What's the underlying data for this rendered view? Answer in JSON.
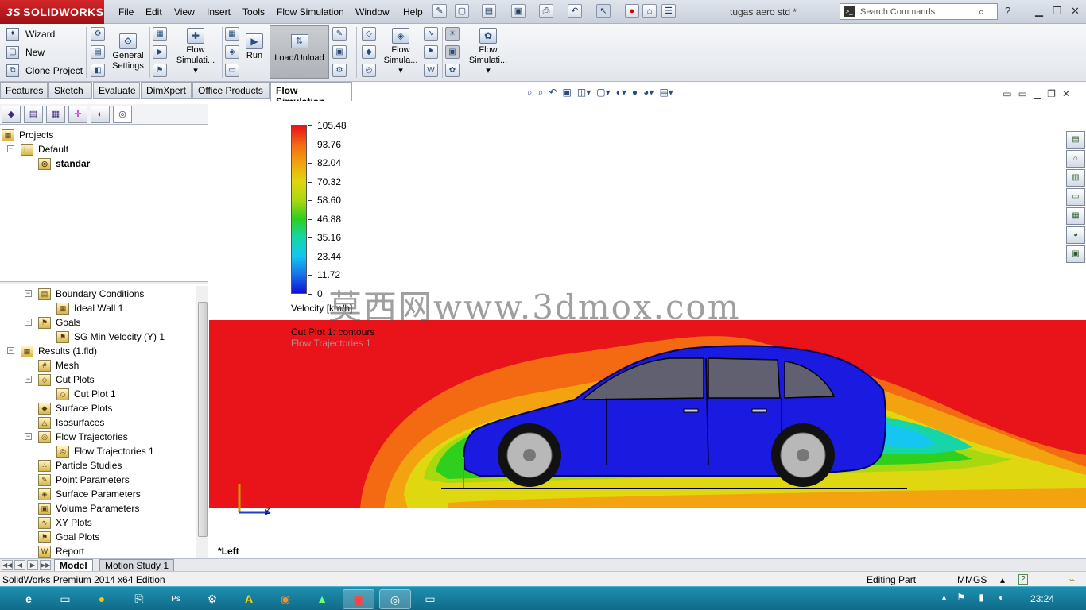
{
  "app": {
    "logo_text": "SOLIDWORKS",
    "doc_title": "tugas aero std *"
  },
  "menu": [
    "File",
    "Edit",
    "View",
    "Insert",
    "Tools",
    "Flow Simulation",
    "Window",
    "Help"
  ],
  "search": {
    "placeholder": "Search Commands"
  },
  "command_manager": {
    "wizard": "Wizard",
    "new": "New",
    "clone": "Clone Project",
    "general_settings": "General Settings",
    "flow_sim_1": "Flow Simulati...",
    "run": "Run",
    "load_unload": "Load/Unload",
    "flow_sim_2": "Flow Simula...",
    "flow_sim_3": "Flow Simulati..."
  },
  "tabs": [
    "Features",
    "Sketch",
    "Evaluate",
    "DimXpert",
    "Office Products",
    "Flow Simulation"
  ],
  "active_tab": "Flow Simulation",
  "projects_tree": {
    "root": "Projects",
    "default": "Default",
    "project": "standar"
  },
  "analysis_tree": [
    {
      "label": "Boundary Conditions",
      "level": 1,
      "icon": "boundary-conditions-icon"
    },
    {
      "label": "Ideal Wall 1",
      "level": 2,
      "icon": "wall-icon"
    },
    {
      "label": "Goals",
      "level": 1,
      "icon": "goals-icon"
    },
    {
      "label": "SG Min Velocity (Y) 1",
      "level": 2,
      "icon": "goal-icon"
    },
    {
      "label": "Results (1.fld)",
      "level": 0,
      "icon": "results-icon"
    },
    {
      "label": "Mesh",
      "level": 1,
      "icon": "mesh-icon"
    },
    {
      "label": "Cut Plots",
      "level": 1,
      "icon": "cut-plots-icon"
    },
    {
      "label": "Cut Plot 1",
      "level": 2,
      "icon": "cut-plot-icon"
    },
    {
      "label": "Surface Plots",
      "level": 1,
      "icon": "surface-plots-icon"
    },
    {
      "label": "Isosurfaces",
      "level": 1,
      "icon": "isosurfaces-icon"
    },
    {
      "label": "Flow Trajectories",
      "level": 1,
      "icon": "flow-trajectories-icon"
    },
    {
      "label": "Flow Trajectories 1",
      "level": 2,
      "icon": "trajectory-icon"
    },
    {
      "label": "Particle Studies",
      "level": 1,
      "icon": "particle-studies-icon"
    },
    {
      "label": "Point Parameters",
      "level": 1,
      "icon": "point-parameters-icon"
    },
    {
      "label": "Surface Parameters",
      "level": 1,
      "icon": "surface-parameters-icon"
    },
    {
      "label": "Volume Parameters",
      "level": 1,
      "icon": "volume-parameters-icon"
    },
    {
      "label": "XY Plots",
      "level": 1,
      "icon": "xy-plots-icon"
    },
    {
      "label": "Goal Plots",
      "level": 1,
      "icon": "goal-plots-icon"
    },
    {
      "label": "Report",
      "level": 1,
      "icon": "report-icon"
    }
  ],
  "legend": {
    "values": [
      "105.48",
      "93.76",
      "82.04",
      "70.32",
      "58.60",
      "46.88",
      "35.16",
      "23.44",
      "11.72",
      "0"
    ],
    "colors": [
      "#e8141a",
      "#f36a12",
      "#f2a30f",
      "#dfd70f",
      "#a8d810",
      "#2fcf1d",
      "#16d6a8",
      "#14c6f0",
      "#1874e8",
      "#1010d8"
    ],
    "title": "Velocity [km/h]",
    "cut_plot": "Cut Plot 1: contours",
    "trajectories": "Flow Trajectories 1"
  },
  "watermark": "莫西网www.3dmox.com",
  "axis_label": "Z",
  "view_name": "*Left",
  "model_tabs": [
    "Model",
    "Motion Study 1"
  ],
  "status": {
    "edition": "SolidWorks Premium 2014 x64 Edition",
    "mode": "Editing Part",
    "units": "MMGS"
  },
  "clock": "23:24"
}
